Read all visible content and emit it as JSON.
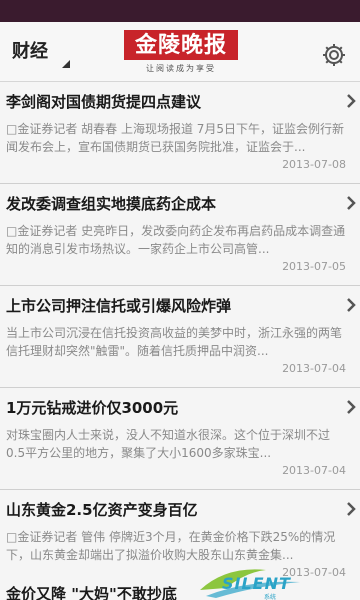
{
  "header": {
    "section": "财经",
    "logo_text": "金陵晚报",
    "slogan": "让阅读成为享受"
  },
  "news": [
    {
      "title": "李剑阁对国债期货提四点建议",
      "summary": "□金证券记者 胡春春 上海现场报道 7月5日下午，证监会例行新闻发布会上，宣布国债期货已获国务院批准，证监会于...",
      "date": "2013-07-08"
    },
    {
      "title": "发改委调查组实地摸底药企成本",
      "summary": "□金证券记者 史亮昨日，发改委向药企发布再启药品成本调查通知的消息引发市场热议。一家药企上市公司高管...",
      "date": "2013-07-05"
    },
    {
      "title": "上市公司押注信托或引爆风险炸弹",
      "summary": "当上市公司沉浸在信托投资高收益的美梦中时，浙江永强的两笔信托理财却突然\"触雷\"。随着信托质押品中润资...",
      "date": "2013-07-04"
    },
    {
      "title": "1万元钻戒进价仅3000元",
      "summary": "对珠宝圈内人士来说，没人不知道水很深。这个位于深圳不过0.5平方公里的地方，聚集了大小1600多家珠宝...",
      "date": "2013-07-04"
    },
    {
      "title": "山东黄金2.5亿资产变身百亿",
      "summary": "□金证券记者 管伟 停牌近3个月，在黄金价格下跌25%的情况下，山东黄金却端出了拟溢价收购大股东山东黄金集...",
      "date": "2013-07-04"
    }
  ],
  "last_item": {
    "title": "金价又降 \"大妈\"不敢抄底"
  },
  "watermark": {
    "text": "SILENT",
    "sub": "系统"
  }
}
